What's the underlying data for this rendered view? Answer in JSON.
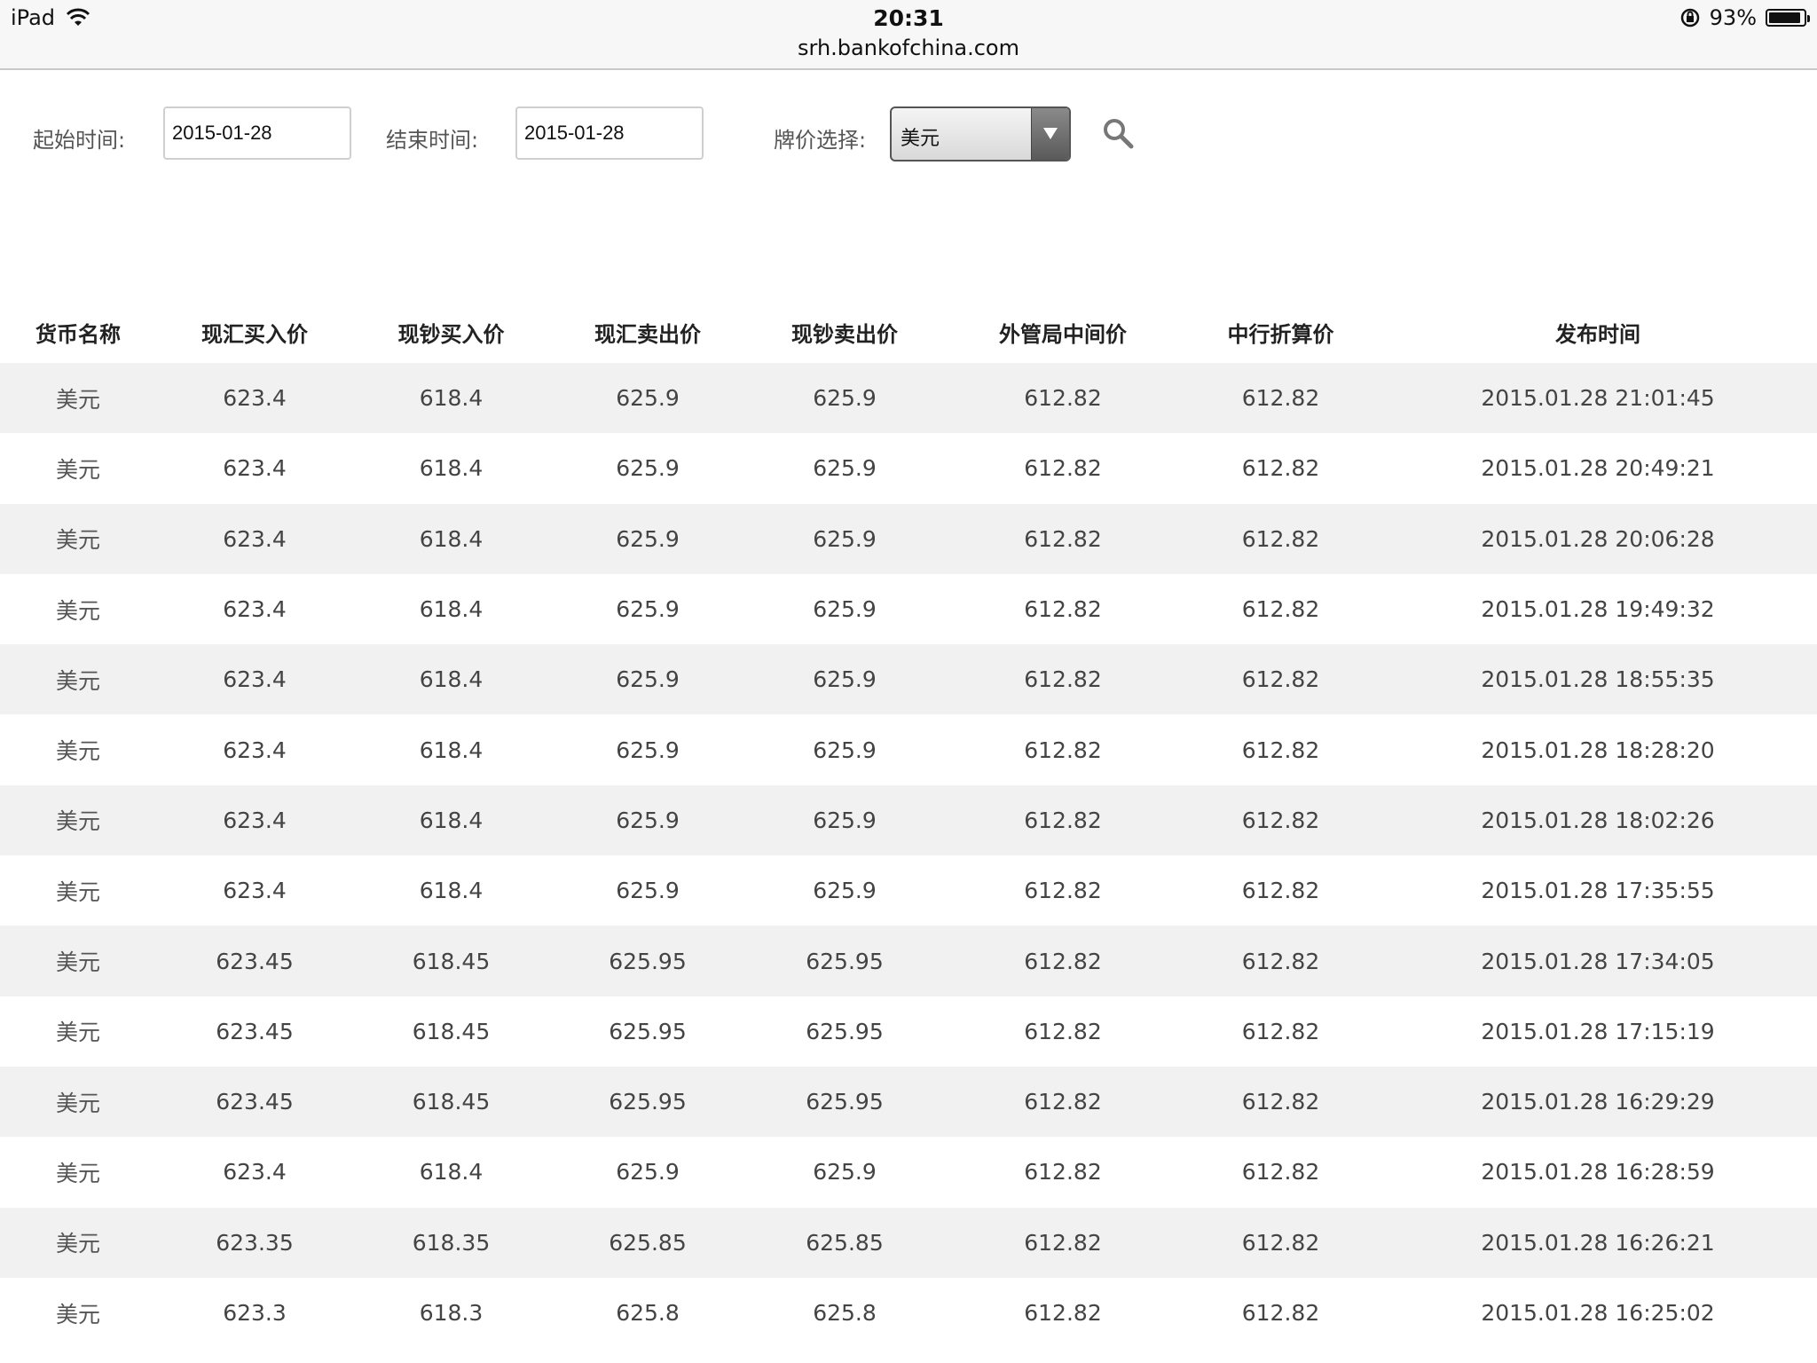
{
  "status_bar": {
    "device": "iPad",
    "time": "20:31",
    "url": "srh.bankofchina.com",
    "battery_text": "93%",
    "battery_level": 0.93
  },
  "filter": {
    "start_label": "起始时间:",
    "start_value": "2015-01-28",
    "end_label": "结束时间:",
    "end_value": "2015-01-28",
    "price_label": "牌价选择:",
    "price_value": "美元"
  },
  "table": {
    "headers": [
      "货币名称",
      "现汇买入价",
      "现钞买入价",
      "现汇卖出价",
      "现钞卖出价",
      "外管局中间价",
      "中行折算价",
      "发布时间"
    ],
    "rows": [
      [
        "美元",
        "623.4",
        "618.4",
        "625.9",
        "625.9",
        "612.82",
        "612.82",
        "2015.01.28 21:01:45"
      ],
      [
        "美元",
        "623.4",
        "618.4",
        "625.9",
        "625.9",
        "612.82",
        "612.82",
        "2015.01.28 20:49:21"
      ],
      [
        "美元",
        "623.4",
        "618.4",
        "625.9",
        "625.9",
        "612.82",
        "612.82",
        "2015.01.28 20:06:28"
      ],
      [
        "美元",
        "623.4",
        "618.4",
        "625.9",
        "625.9",
        "612.82",
        "612.82",
        "2015.01.28 19:49:32"
      ],
      [
        "美元",
        "623.4",
        "618.4",
        "625.9",
        "625.9",
        "612.82",
        "612.82",
        "2015.01.28 18:55:35"
      ],
      [
        "美元",
        "623.4",
        "618.4",
        "625.9",
        "625.9",
        "612.82",
        "612.82",
        "2015.01.28 18:28:20"
      ],
      [
        "美元",
        "623.4",
        "618.4",
        "625.9",
        "625.9",
        "612.82",
        "612.82",
        "2015.01.28 18:02:26"
      ],
      [
        "美元",
        "623.4",
        "618.4",
        "625.9",
        "625.9",
        "612.82",
        "612.82",
        "2015.01.28 17:35:55"
      ],
      [
        "美元",
        "623.45",
        "618.45",
        "625.95",
        "625.95",
        "612.82",
        "612.82",
        "2015.01.28 17:34:05"
      ],
      [
        "美元",
        "623.45",
        "618.45",
        "625.95",
        "625.95",
        "612.82",
        "612.82",
        "2015.01.28 17:15:19"
      ],
      [
        "美元",
        "623.45",
        "618.45",
        "625.95",
        "625.95",
        "612.82",
        "612.82",
        "2015.01.28 16:29:29"
      ],
      [
        "美元",
        "623.4",
        "618.4",
        "625.9",
        "625.9",
        "612.82",
        "612.82",
        "2015.01.28 16:28:59"
      ],
      [
        "美元",
        "623.35",
        "618.35",
        "625.85",
        "625.85",
        "612.82",
        "612.82",
        "2015.01.28 16:26:21"
      ],
      [
        "美元",
        "623.3",
        "618.3",
        "625.8",
        "625.8",
        "612.82",
        "612.82",
        "2015.01.28 16:25:02"
      ]
    ]
  }
}
